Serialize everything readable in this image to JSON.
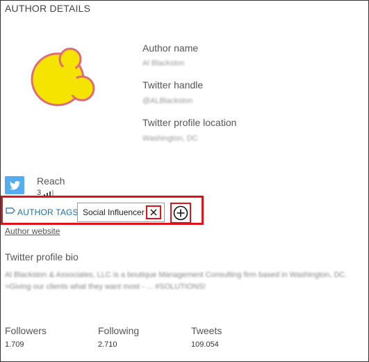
{
  "section_title": "AUTHOR DETAILS",
  "author": {
    "name_label": "Author name",
    "name_value": "Al Blackston",
    "handle_label": "Twitter handle",
    "handle_value": "@ALBlackston",
    "location_label": "Twitter profile location",
    "location_value": "Washington, DC"
  },
  "reach": {
    "label": "Reach",
    "value": "3"
  },
  "tags": {
    "label": "AUTHOR TAGS",
    "items": [
      "Social Influencer"
    ]
  },
  "website_link": "Author website",
  "bio": {
    "label": "Twitter profile bio",
    "text": "Al Blackston & Associates, LLC is a boutique Management Consulting firm based in Washington, DC. >Giving our clients what they want most - ... #SOLUTIONS!"
  },
  "stats": {
    "followers_label": "Followers",
    "followers_value": "1.709",
    "following_label": "Following",
    "following_value": "2.710",
    "tweets_label": "Tweets",
    "tweets_value": "109.054"
  },
  "colors": {
    "highlight": "#e0131b",
    "twitter_blue": "#55acee",
    "link_blue": "#1b6ea8",
    "avatar_yellow": "#f5e400",
    "avatar_outline": "#e06a7a"
  },
  "icons": [
    "twitter-icon",
    "tag-icon",
    "close-icon",
    "add-circle-icon"
  ]
}
